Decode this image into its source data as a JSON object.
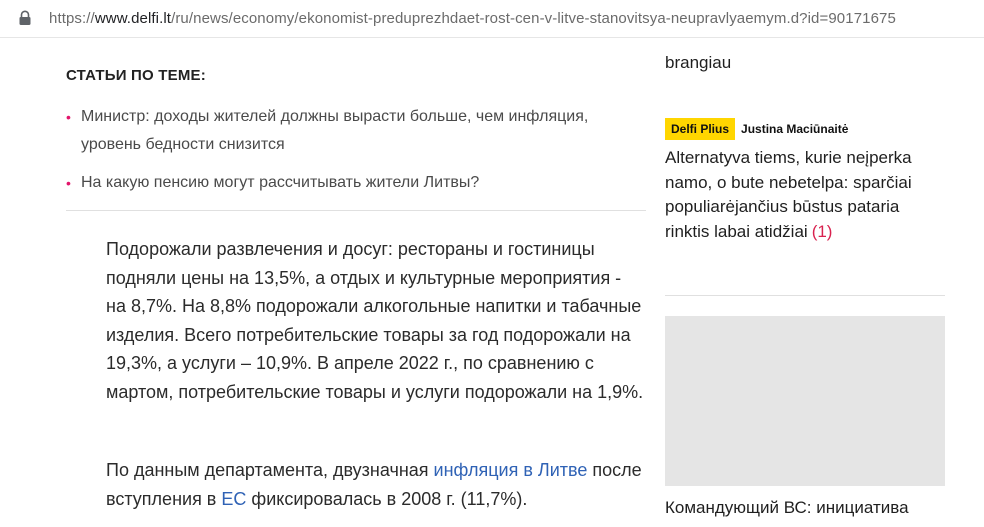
{
  "browser": {
    "url_prefix": "https://",
    "url_domain": "www.delfi.lt",
    "url_path": "/ru/news/economy/ekonomist-preduprezhdaet-rost-cen-v-litve-stanovitsya-neupravlyaemym.d?id=90171675"
  },
  "related": {
    "heading": "СТАТЬИ ПО ТЕМЕ:",
    "items": [
      {
        "bullet": "•",
        "text": "Министр: доходы жителей должны вырасти больше, чем инфляция, уровень бедности снизится"
      },
      {
        "bullet": "•",
        "text": "На какую пенсию могут рассчитывать жители Литвы?"
      }
    ]
  },
  "article": {
    "p1": "Подорожали развлечения и досуг: рестораны и гостиницы подняли цены на 13,5%, а отдых и культурные мероприятия - на 8,7%. На 8,8% подорожали алкогольные напитки и табачные изделия. Всего потребительские товары за год подорожали на 19,3%, а услуги – 10,9%. В апреле 2022 г., по сравнению с мартом, потребительские товары и услуги подорожали на 1,9%.",
    "p2_a": "По данным департамента, двузначная ",
    "p2_link1": "инфляция в Литве",
    "p2_b": " после вступления в ",
    "p2_link2": "ЕС",
    "p2_c": " фиксировалась в 2008 г. (11,7%)."
  },
  "sidebar": {
    "prev_tail": "brangiau",
    "badge": "Delfi Plius",
    "author": "Justina Maciūnaitė",
    "headline": "Alternatyva tiems, kurie neįperka namo, o bute nebetelpa: sparčiai populiarėjančius būstus pataria rinktis labai atidžiai",
    "comment_count": "(1)",
    "headline2": "Командующий ВС: инициатива"
  },
  "colors": {
    "accent_bullet": "#e2156b",
    "link": "#2f62b5",
    "badge_bg": "#ffd600",
    "comment": "#d9224f"
  }
}
